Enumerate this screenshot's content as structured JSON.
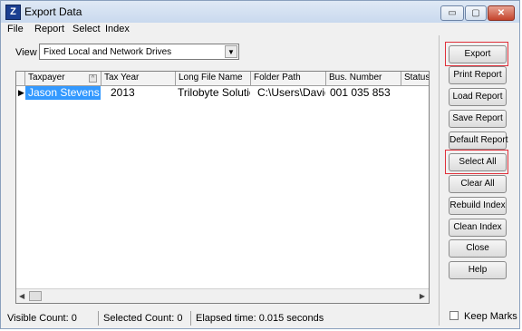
{
  "window": {
    "title": "Export Data",
    "app_icon_glyph": "Z",
    "controls": {
      "minimize": "▭",
      "maximize": "▢",
      "close": "✕"
    }
  },
  "menu": [
    "File",
    "Report",
    "Select",
    "Index"
  ],
  "view": {
    "label": "View",
    "selected": "Fixed Local and Network Drives"
  },
  "grid": {
    "columns": [
      "Taxpayer",
      "Tax Year",
      "Long File Name",
      "Folder Path",
      "Bus. Number",
      "Status"
    ],
    "sort_indicator": "^",
    "rows": [
      {
        "taxpayer": "Jason Stevens",
        "tax_year": "2013",
        "long_file_name": "Trilobyte Solutio",
        "folder_path": "C:\\Users\\David",
        "bus_number": "001 035 853",
        "status": ""
      }
    ]
  },
  "buttons": [
    "Export",
    "Print Report",
    "Load Report",
    "Save Report",
    "Default Report",
    "Select All",
    "Clear All",
    "Rebuild Index",
    "Clean Index",
    "Close",
    "Help"
  ],
  "highlighted_buttons": [
    "Export",
    "Select All"
  ],
  "keep_marks": {
    "label": "Keep Marks",
    "checked": false
  },
  "status": {
    "visible_count": "Visible Count:  0",
    "selected_count": "Selected Count:  0",
    "elapsed": "Elapsed time:  0.015 seconds"
  },
  "colors": {
    "selection": "#3399ff",
    "highlight_box": "#e0303a"
  }
}
